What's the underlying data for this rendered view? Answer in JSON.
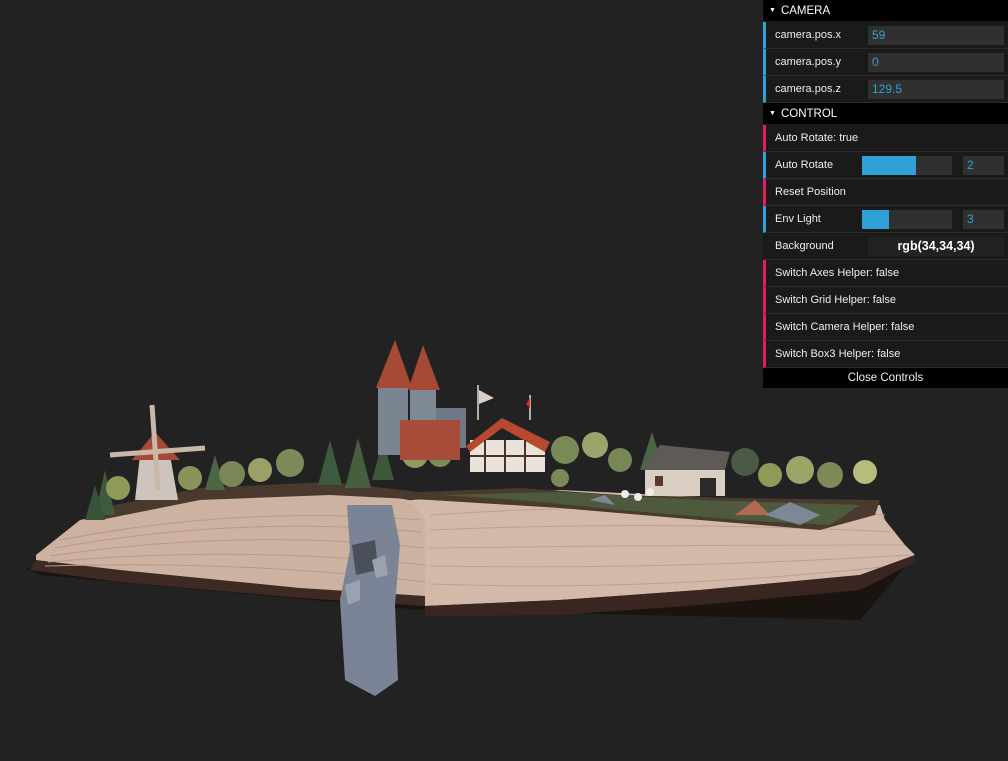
{
  "gui": {
    "camera_folder": "CAMERA",
    "camera": [
      {
        "label": "camera.pos.x",
        "value": "59"
      },
      {
        "label": "camera.pos.y",
        "value": "0"
      },
      {
        "label": "camera.pos.z",
        "value": "129.5"
      }
    ],
    "control_folder": "CONTROL",
    "auto_rotate_toggle": "Auto Rotate: true",
    "auto_rotate": {
      "label": "Auto Rotate",
      "value": "2",
      "fraction": 0.6
    },
    "reset_position": "Reset Position",
    "env_light": {
      "label": "Env Light",
      "value": "3",
      "fraction": 0.3
    },
    "background": {
      "label": "Background",
      "value": "rgb(34,34,34)"
    },
    "switches": [
      "Switch Axes Helper: false",
      "Switch Grid Helper: false",
      "Switch Camera Helper: false",
      "Switch Box3 Helper: false"
    ],
    "close": "Close Controls"
  },
  "colors": {
    "background": "#222222",
    "accent_number": "#2fa1d6",
    "accent_function": "#e61d5f"
  }
}
